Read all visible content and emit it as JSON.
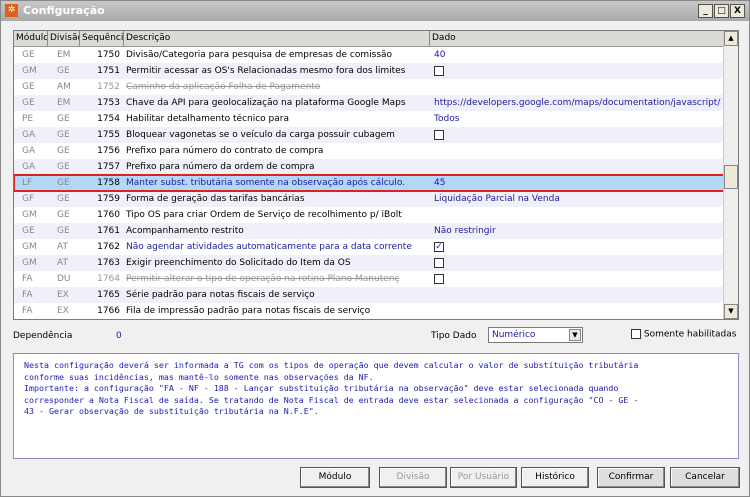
{
  "window": {
    "title": "Configuração",
    "controls": [
      "_",
      "□",
      "X"
    ]
  },
  "grid": {
    "columns": [
      "Módulo",
      "Divisão",
      "Sequência",
      "Descrição",
      "Dado"
    ],
    "rows": [
      {
        "modulo": "GE",
        "divisao": "EM",
        "seq": "1750",
        "descricao": "Divisão/Categoria para pesquisa de empresas de comissão",
        "dado": "40"
      },
      {
        "modulo": "GM",
        "divisao": "GE",
        "seq": "1751",
        "descricao": "Permitir acessar as OS's Relacionadas mesmo fora dos limites",
        "dado": "",
        "checkbox": false
      },
      {
        "modulo": "GE",
        "divisao": "AM",
        "seq": "1752",
        "descricao": "Caminho da aplicação Folha de Pagamento",
        "dado": "",
        "deleted": true
      },
      {
        "modulo": "GE",
        "divisao": "EM",
        "seq": "1753",
        "descricao": "Chave da API para geolocalização na plataforma Google Maps",
        "dado": "https://developers.google.com/maps/documentation/javascript/"
      },
      {
        "modulo": "PE",
        "divisao": "GE",
        "seq": "1754",
        "descricao": "Habilitar detalhamento técnico para",
        "dado": "Todos"
      },
      {
        "modulo": "GA",
        "divisao": "GE",
        "seq": "1755",
        "descricao": "Bloquear vagonetas se o veículo da carga possuir cubagem",
        "dado": "",
        "checkbox": false
      },
      {
        "modulo": "GA",
        "divisao": "GE",
        "seq": "1756",
        "descricao": "Prefixo para número do contrato de compra",
        "dado": ""
      },
      {
        "modulo": "GA",
        "divisao": "GE",
        "seq": "1757",
        "descricao": "Prefixo para número da ordem de compra",
        "dado": ""
      },
      {
        "modulo": "LF",
        "divisao": "GE",
        "seq": "1758",
        "descricao": "Manter subst. tributária somente na observação após cálculo.",
        "dado": "45",
        "selected": true
      },
      {
        "modulo": "GF",
        "divisao": "GE",
        "seq": "1759",
        "descricao": "Forma de geração das tarifas bancárias",
        "dado": "Liquidação Parcial na Venda"
      },
      {
        "modulo": "GM",
        "divisao": "GE",
        "seq": "1760",
        "descricao": "Tipo OS para criar Ordem de Serviço de recolhimento p/ iBolt",
        "dado": ""
      },
      {
        "modulo": "GE",
        "divisao": "GE",
        "seq": "1761",
        "descricao": "Acompanhamento restrito",
        "dado": "Não restringir"
      },
      {
        "modulo": "GM",
        "divisao": "AT",
        "seq": "1762",
        "descricao": "Não agendar atividades automaticamente para a data corrente",
        "dado": "",
        "checkbox": true,
        "blue": true
      },
      {
        "modulo": "GM",
        "divisao": "AT",
        "seq": "1763",
        "descricao": "Exigir preenchimento do Solicitado do Item da OS",
        "dado": "",
        "checkbox": false
      },
      {
        "modulo": "FA",
        "divisao": "DU",
        "seq": "1764",
        "descricao": "Permitir alterar o tipo de operação na rotina Plano Manutenç",
        "dado": "",
        "checkbox": false,
        "deleted": true
      },
      {
        "modulo": "FA",
        "divisao": "EX",
        "seq": "1765",
        "descricao": "Série padrão para notas fiscais de serviço",
        "dado": ""
      },
      {
        "modulo": "FA",
        "divisao": "EX",
        "seq": "1766",
        "descricao": "Fila de impressão padrão para notas fiscais de serviço",
        "dado": ""
      }
    ]
  },
  "footer": {
    "dependencia_label": "Dependência",
    "dependencia_value": "0",
    "tipo_dado_label": "Tipo Dado",
    "tipo_dado_value": "Numérico",
    "somente_label": "Somente habilitadas"
  },
  "description": "Nesta configuração deverá ser informada a TG com os tipos de operação que devem calcular o valor de substituição tributária\nconforme suas incidências, mas mantê-lo somente nas observações da NF.\nImportante: a configuração \"FA - NF - 188 - Lançar substituição tributária na observação\" deve estar selecionada quando\ncorresponder a Nota Fiscal de saída. Se tratando de Nota Fiscal de entrada deve estar selecionada a configuração \"CO - GE -\n43 - Gerar observação de substituição tributária na N.F.E\".",
  "buttons": {
    "modulo": "Módulo",
    "divisao": "Divisão",
    "por_usuario": "Por Usuário",
    "historico": "Histórico",
    "confirmar": "Confirmar",
    "cancelar": "Cancelar"
  }
}
